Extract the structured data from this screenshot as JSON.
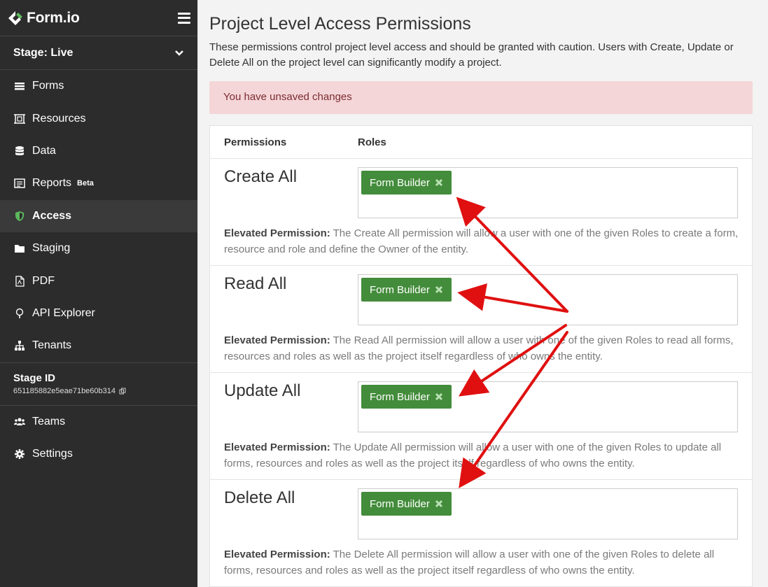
{
  "brand": {
    "name": "Form.io"
  },
  "stage": {
    "label": "Stage: Live"
  },
  "nav": [
    {
      "label": "Forms",
      "icon": "forms-icon"
    },
    {
      "label": "Resources",
      "icon": "resources-icon"
    },
    {
      "label": "Data",
      "icon": "database-icon"
    },
    {
      "label": "Reports",
      "icon": "reports-icon",
      "badge": "Beta"
    },
    {
      "label": "Access",
      "icon": "shield-icon",
      "active": true
    },
    {
      "label": "Staging",
      "icon": "folder-icon"
    },
    {
      "label": "PDF",
      "icon": "pdf-icon"
    },
    {
      "label": "API Explorer",
      "icon": "lightbulb-icon"
    },
    {
      "label": "Tenants",
      "icon": "sitemap-icon"
    }
  ],
  "stage_id": {
    "label": "Stage ID",
    "value": "651185882e5eae71be60b314"
  },
  "bottom_nav": [
    {
      "label": "Teams",
      "icon": "users-icon"
    },
    {
      "label": "Settings",
      "icon": "gear-icon"
    }
  ],
  "page": {
    "title": "Project Level Access Permissions",
    "description": "These permissions control project level access and should be granted with caution. Users with Create, Update or Delete All on the project level can significantly modify a project.",
    "alert": "You have unsaved changes"
  },
  "table": {
    "col_permissions": "Permissions",
    "col_roles": "Roles",
    "rows": [
      {
        "name": "Create All",
        "role": "Form Builder",
        "desc_label": "Elevated Permission:",
        "desc": " The Create All permission will allow a user with one of the given Roles to create a form, resource and role and define the Owner of the entity."
      },
      {
        "name": "Read All",
        "role": "Form Builder",
        "desc_label": "Elevated Permission:",
        "desc": " The Read All permission will allow a user with one of the given Roles to read all forms, resources and roles as well as the project itself regardless of who owns the entity."
      },
      {
        "name": "Update All",
        "role": "Form Builder",
        "desc_label": "Elevated Permission:",
        "desc": " The Update All permission will allow a user with one of the given Roles to update all forms, resources and roles as well as the project itself regardless of who owns the entity."
      },
      {
        "name": "Delete All",
        "role": "Form Builder",
        "desc_label": "Elevated Permission:",
        "desc": " The Delete All permission will allow a user with one of the given Roles to delete all forms, resources and roles as well as the project itself regardless of who owns the entity."
      }
    ]
  },
  "colors": {
    "sidebar": "#2b2c2b",
    "accent_green": "#438c3b",
    "alert_bg": "#f5d6d8",
    "arrow": "#e01010"
  }
}
